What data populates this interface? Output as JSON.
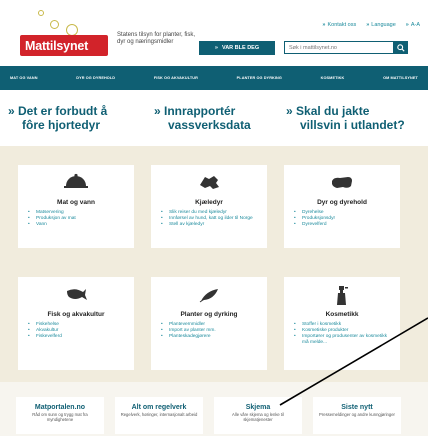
{
  "header": {
    "logo_text": "Mattilsynet",
    "tagline": "Statens tilsyn for planter, fisk, dyr og næringsmidler",
    "links": [
      "Kontakt oss",
      "Language",
      "A-A"
    ],
    "animals_button": "VAR BLE DEG",
    "search_placeholder": "Søk i mattilsynet.no"
  },
  "nav": {
    "items": [
      "MAT OG VANN",
      "DYR OG DYREHOLD",
      "FISK OG AKVAKULTUR",
      "PLANTER OG DYRKING",
      "KOSMETIKK",
      "OM MATTILSYNET"
    ]
  },
  "highlights": [
    {
      "line1": "Det er forbudt å",
      "line2": "fôre hjortedyr"
    },
    {
      "line1": "Innrapportér",
      "line2": "vassverksdata"
    },
    {
      "line1": "Skal du jakte",
      "line2": "villsvin i utlandet?"
    }
  ],
  "categories": [
    {
      "title": "Mat og vann",
      "icon": "cloche-icon",
      "items": [
        "Matservering",
        "Produksjon av mat",
        "Vann"
      ]
    },
    {
      "title": "Kjæledyr",
      "icon": "dog-icon",
      "items": [
        "Slik reiser du med kjæledyr",
        "Innførsel av hund, katt og ilder til Norge",
        "Stell av kjæledyr"
      ]
    },
    {
      "title": "Dyr og dyrehold",
      "icon": "cow-icon",
      "items": [
        "Dyrehelse",
        "Produksjonsdyr",
        "Dyrevelferd"
      ]
    },
    {
      "title": "Fisk og akvakultur",
      "icon": "fish-icon",
      "items": [
        "Fiskehelse",
        "Akvakultur",
        "Fiskevelferd"
      ]
    },
    {
      "title": "Planter og dyrking",
      "icon": "leaf-icon",
      "items": [
        "Plantevernmidler",
        "Import av planter mm.",
        "Planteskadegjørere"
      ]
    },
    {
      "title": "Kosmetikk",
      "icon": "spray-bottle-icon",
      "items": [
        "Stoffer i kosmetikk",
        "Kosmetiske produkter",
        "Importører og produsenter av kosmetikk må melde..."
      ]
    }
  ],
  "footer": [
    {
      "title": "Matportalen.no",
      "sub": "Råd om sunn og trygg mat fra myndighetene"
    },
    {
      "title": "Alt om regelverk",
      "sub": "Regelverk, høringer, internasjonalt arbeid"
    },
    {
      "title": "Skjema",
      "sub": "Alle våre skjema og lenke til skjematjenester"
    },
    {
      "title": "Siste nytt",
      "sub": "Pressemeldinger og andre kunngjøringer"
    }
  ],
  "colors": {
    "brand_red": "#d2232a",
    "teal": "#0f5f73",
    "link": "#1b8a9c",
    "beige": "#f1ecdd"
  }
}
